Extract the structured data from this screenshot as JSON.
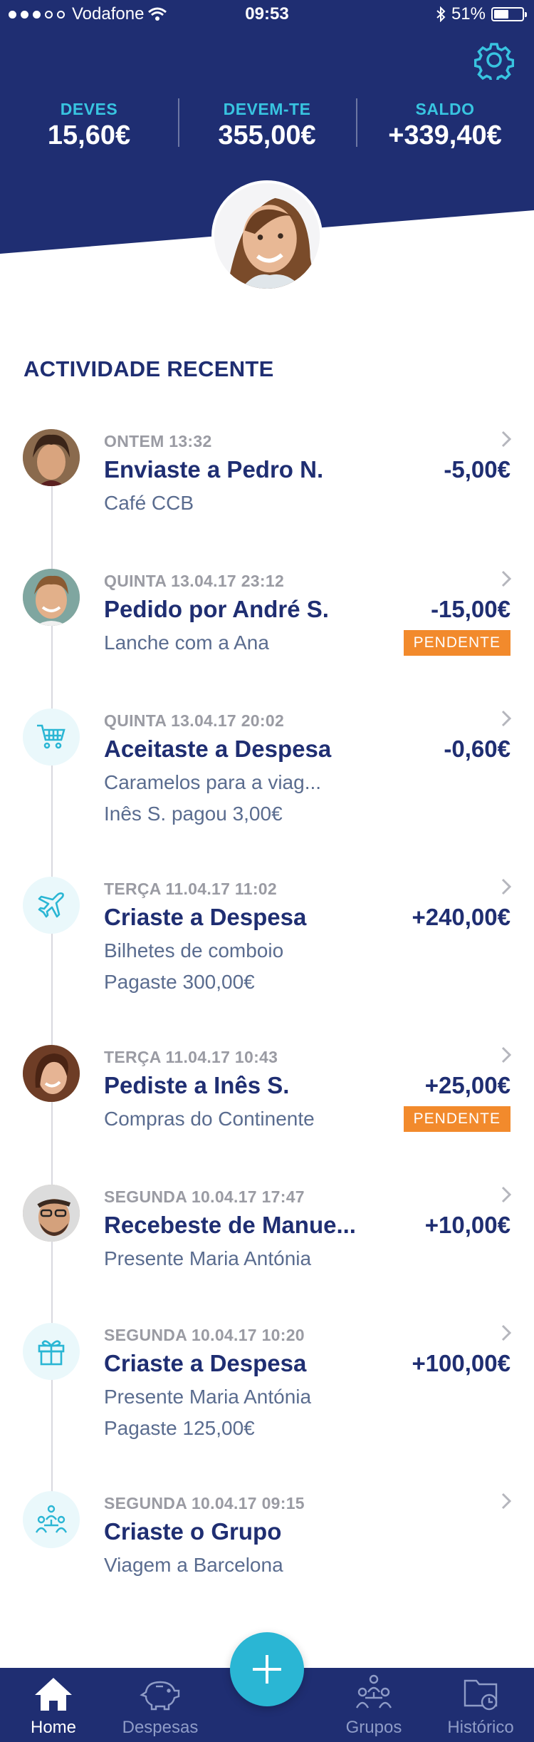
{
  "status_bar": {
    "carrier": "Vodafone",
    "time": "09:53",
    "battery": "51%"
  },
  "balances": [
    {
      "label": "DEVES",
      "value": "15,60€"
    },
    {
      "label": "DEVEM-TE",
      "value": "355,00€"
    },
    {
      "label": "SALDO",
      "value": "+339,40€"
    }
  ],
  "section_title": "ACTIVIDADE RECENTE",
  "activities": [
    {
      "date": "ONTEM 13:32",
      "title": "Enviaste a Pedro N.",
      "subtitle": "Café CCB",
      "amount": "-5,00€",
      "icon": "avatar-pedro"
    },
    {
      "date": "QUINTA 13.04.17 23:12",
      "title": "Pedido por André S.",
      "subtitle": "Lanche com a Ana",
      "amount": "-15,00€",
      "badge": "PENDENTE",
      "icon": "avatar-andre"
    },
    {
      "date": "QUINTA 13.04.17 20:02",
      "title": "Aceitaste a Despesa",
      "subtitle": "Caramelos para a viag...",
      "subtitle2": "Inês S. pagou 3,00€",
      "amount": "-0,60€",
      "icon": "shopping-cart-icon"
    },
    {
      "date": "TERÇA 11.04.17 11:02",
      "title": "Criaste a Despesa",
      "subtitle": "Bilhetes de comboio",
      "subtitle2": "Pagaste 300,00€",
      "amount": "+240,00€",
      "icon": "airplane-icon"
    },
    {
      "date": "TERÇA 11.04.17 10:43",
      "title": "Pediste a Inês S.",
      "subtitle": "Compras do Continente",
      "amount": "+25,00€",
      "badge": "PENDENTE",
      "icon": "avatar-ines"
    },
    {
      "date": "SEGUNDA 10.04.17 17:47",
      "title": "Recebeste de Manue...",
      "subtitle": "Presente Maria Antónia",
      "amount": "+10,00€",
      "icon": "avatar-manuel"
    },
    {
      "date": "SEGUNDA 10.04.17 10:20",
      "title": "Criaste a Despesa",
      "subtitle": "Presente Maria Antónia",
      "subtitle2": "Pagaste 125,00€",
      "amount": "+100,00€",
      "icon": "gift-icon"
    },
    {
      "date": "SEGUNDA 10.04.17 09:15",
      "title": "Criaste o Grupo",
      "subtitle": "Viagem a Barcelona",
      "amount": "",
      "icon": "group-icon"
    }
  ],
  "tabs": [
    {
      "label": "Home",
      "icon": "home-icon",
      "active": true
    },
    {
      "label": "Despesas",
      "icon": "piggy-bank-icon",
      "active": false
    },
    {
      "label": "",
      "icon": "",
      "active": false
    },
    {
      "label": "Grupos",
      "icon": "group-icon",
      "active": false
    },
    {
      "label": "Histórico",
      "icon": "history-folder-icon",
      "active": false
    }
  ],
  "colors": {
    "primary": "#1f2e72",
    "accent": "#2ab6d4",
    "pending": "#f28a2c"
  }
}
